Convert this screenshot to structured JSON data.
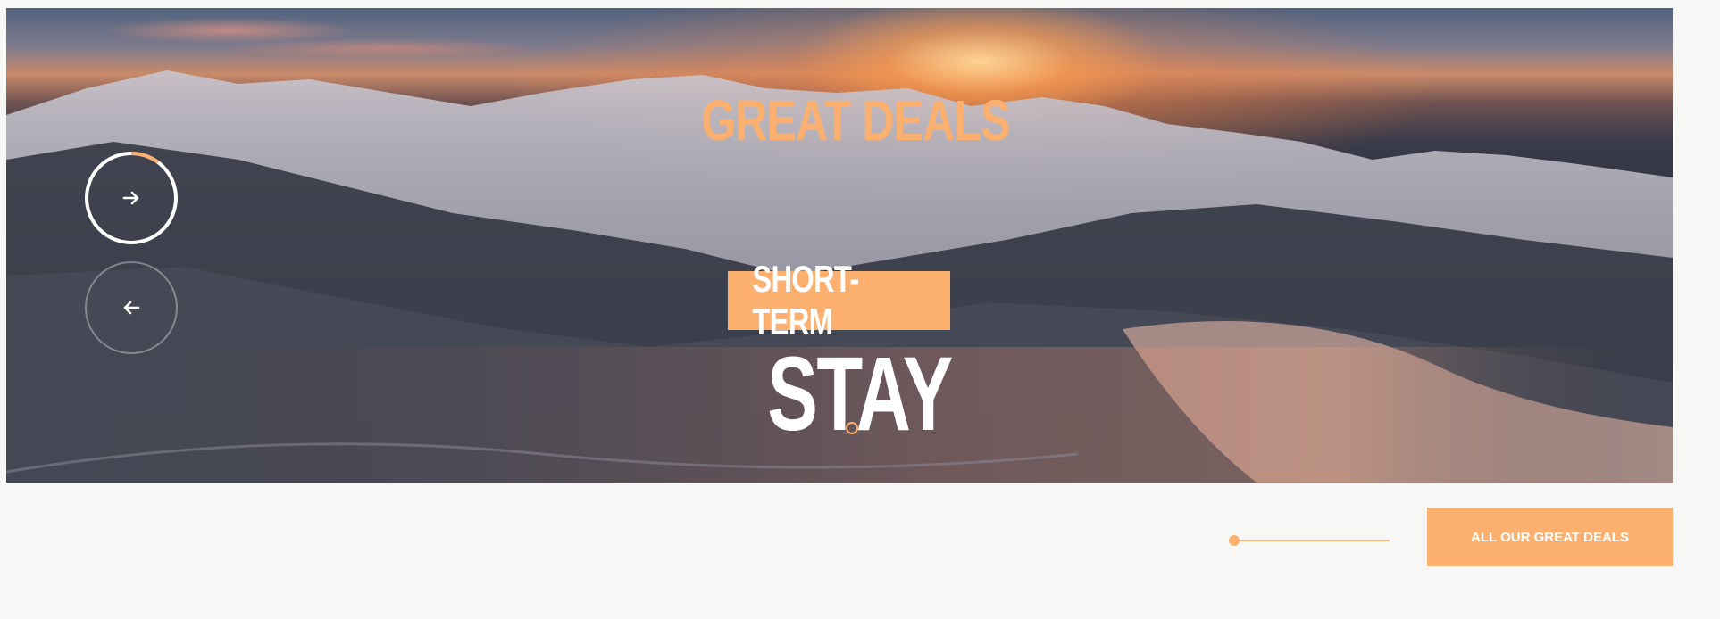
{
  "hero": {
    "heading": "GREAT DEALS",
    "badge": "SHORT-TERM",
    "title": "STAY",
    "prev_icon": "arrow-left-icon",
    "next_icon": "arrow-right-icon"
  },
  "cta": {
    "label": "ALL OUR GREAT DEALS"
  },
  "colors": {
    "accent": "#fcb06f",
    "background": "#f7f7f6",
    "text_on_image": "#ffffff"
  }
}
